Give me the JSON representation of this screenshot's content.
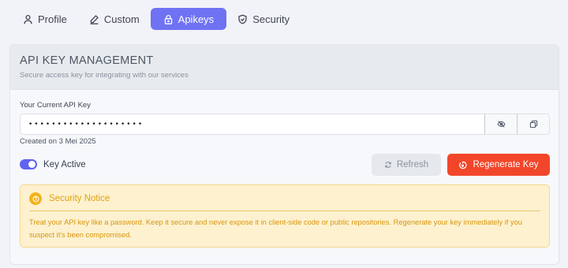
{
  "tabs": [
    {
      "label": "Profile",
      "icon": "user-icon",
      "active": false
    },
    {
      "label": "Custom",
      "icon": "pen-icon",
      "active": false
    },
    {
      "label": "Apikeys",
      "icon": "lock-icon",
      "active": true
    },
    {
      "label": "Security",
      "icon": "shield-icon",
      "active": false
    }
  ],
  "card": {
    "title": "API KEY MANAGEMENT",
    "subtitle": "Secure access key for integrating with our services"
  },
  "api_key": {
    "label": "Your Current API Key",
    "value": "••••••••••••••••••••",
    "created": "Created on 3 Mei 2025",
    "toggle_visibility_icon": "eye-off-icon",
    "copy_icon": "copy-icon"
  },
  "status": {
    "toggle_label": "Key Active",
    "active": true
  },
  "buttons": {
    "refresh": "Refresh",
    "regenerate": "Regenerate Key"
  },
  "notice": {
    "title": "Security Notice",
    "text": "Treat your API key like a password. Keep it secure and never expose it in client-side code or public repositories. Regenerate your key immediately if you suspect it's been compromised."
  },
  "colors": {
    "accent": "#6f72f2",
    "danger": "#f2462a",
    "warning_bg": "#fdf1cf",
    "warning_text": "#e0a10f"
  }
}
